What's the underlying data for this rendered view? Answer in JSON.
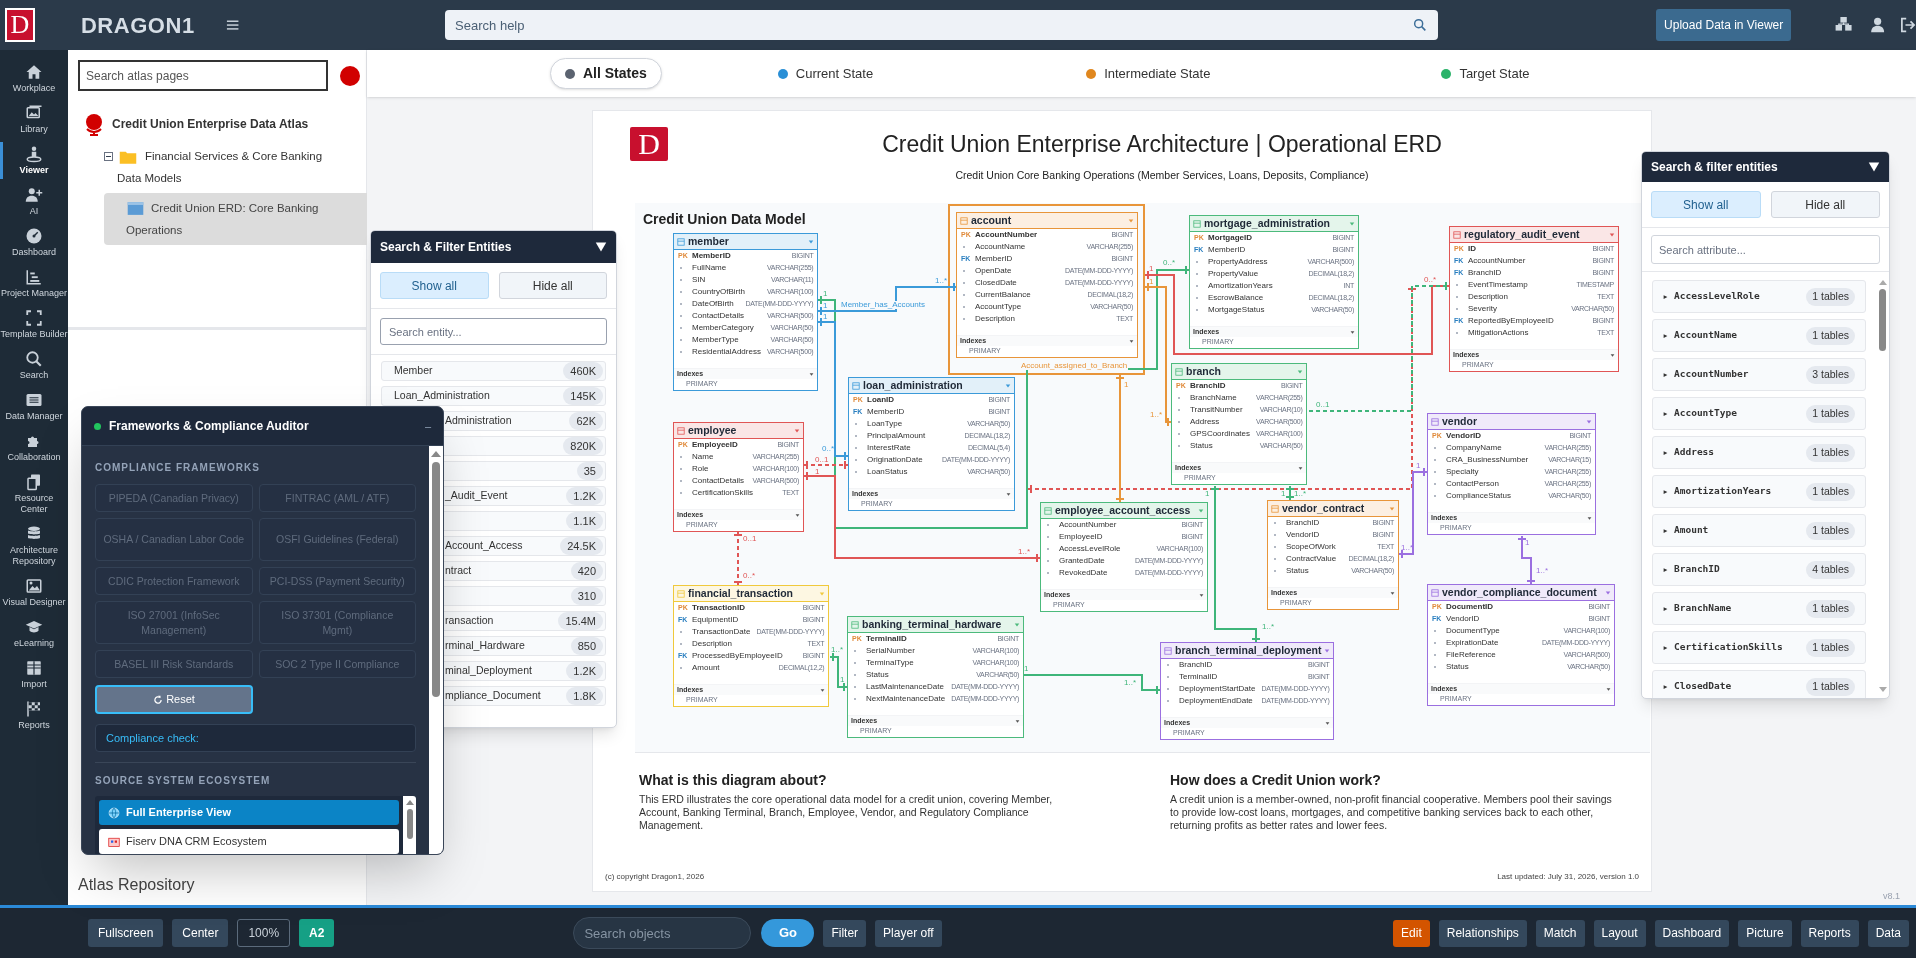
{
  "topbar": {
    "logo": "D",
    "brand": "DRAGON1",
    "search_placeholder": "Search help",
    "upload_button": "Upload Data in Viewer"
  },
  "sidebar": {
    "items": [
      {
        "label": "Workplace",
        "selected": false
      },
      {
        "label": "Library",
        "selected": false
      },
      {
        "label": "Viewer",
        "selected": true
      },
      {
        "label": "AI",
        "selected": false
      },
      {
        "label": "Dashboard",
        "selected": false
      },
      {
        "label": "Project Manager",
        "selected": false
      },
      {
        "label": "Template Builder",
        "selected": false
      },
      {
        "label": "Search",
        "selected": false
      },
      {
        "label": "Data Manager",
        "selected": false
      },
      {
        "label": "Collaboration",
        "selected": false
      },
      {
        "label": "Resource Center",
        "selected": false
      },
      {
        "label": "Architecture Repository",
        "selected": false
      },
      {
        "label": "Visual Designer",
        "selected": false
      },
      {
        "label": "eLearning",
        "selected": false
      },
      {
        "label": "Import",
        "selected": false
      },
      {
        "label": "Reports",
        "selected": false
      }
    ]
  },
  "atlas": {
    "search_placeholder": "Search atlas pages",
    "root": {
      "label": "Credit Union Enterprise Data Atlas",
      "children": [
        {
          "label": "Financial Services & Core Banking Data Models",
          "expanded": true,
          "children": [
            {
              "label": "Credit Union ERD: Core Banking Operations",
              "selected": true
            }
          ]
        }
      ]
    },
    "footer": "Atlas Repository"
  },
  "states": [
    {
      "label": "All States",
      "selected": true,
      "color": "#5b6370"
    },
    {
      "label": "Current State",
      "selected": false,
      "color": "#2a8fd6"
    },
    {
      "label": "Intermediate State",
      "selected": false,
      "color": "#e0871e"
    },
    {
      "label": "Target State",
      "selected": false,
      "color": "#2bb36a"
    }
  ],
  "diagram": {
    "logo": "D",
    "title": "Credit Union Enterprise Architecture | Operational ERD",
    "subtitle": "Credit Union Core Banking Operations (Member Services, Loans, Deposits, Compliance)",
    "model_title": "Credit Union Data Model",
    "tables": [
      {
        "name": "member",
        "color": "#3b9ad9",
        "columns": [
          {
            "key": "PK",
            "name": "MemberID",
            "type": "BIGINT"
          },
          {
            "name": "FullName",
            "type": "VARCHAR(255)"
          },
          {
            "name": "SIN",
            "type": "VARCHAR(11)"
          },
          {
            "name": "CountryOfBirth",
            "type": "VARCHAR(100)"
          },
          {
            "name": "DateOfBirth",
            "type": "DATE(MM-DDD-YYYY)"
          },
          {
            "name": "ContactDetails",
            "type": "VARCHAR(500)"
          },
          {
            "name": "MemberCategory",
            "type": "VARCHAR(50)"
          },
          {
            "name": "MemberType",
            "type": "VARCHAR(50)"
          },
          {
            "name": "ResidentialAddress",
            "type": "VARCHAR(500)"
          }
        ],
        "indexes_label": "Indexes",
        "indexes": [
          "PRIMARY"
        ]
      },
      {
        "name": "account",
        "color": "#e8953a",
        "columns": [
          {
            "key": "PK",
            "name": "AccountNumber",
            "type": "BIGINT"
          },
          {
            "name": "AccountName",
            "type": "VARCHAR(255)"
          },
          {
            "key": "FK",
            "name": "MemberID",
            "type": "BIGINT"
          },
          {
            "name": "OpenDate",
            "type": "DATE(MM-DDD-YYYY)"
          },
          {
            "name": "ClosedDate",
            "type": "DATE(MM-DDD-YYYY)"
          },
          {
            "name": "CurrentBalance",
            "type": "DECIMAL(18,2)"
          },
          {
            "name": "AccountType",
            "type": "VARCHAR(50)"
          },
          {
            "name": "Description",
            "type": "TEXT"
          }
        ],
        "indexes_label": "Indexes",
        "indexes": [
          "PRIMARY"
        ]
      },
      {
        "name": "mortgage_administration",
        "color": "#4cba7c",
        "columns": [
          {
            "key": "PK",
            "name": "MortgageID",
            "type": "BIGINT"
          },
          {
            "key": "FK",
            "name": "MemberID",
            "type": "BIGINT"
          },
          {
            "name": "PropertyAddress",
            "type": "VARCHAR(500)"
          },
          {
            "name": "PropertyValue",
            "type": "DECIMAL(18,2)"
          },
          {
            "name": "AmortizationYears",
            "type": "INT"
          },
          {
            "name": "EscrowBalance",
            "type": "DECIMAL(18,2)"
          },
          {
            "name": "MortgageStatus",
            "type": "VARCHAR(50)"
          }
        ],
        "indexes_label": "Indexes",
        "indexes": [
          "PRIMARY"
        ]
      },
      {
        "name": "regulatory_audit_event",
        "color": "#e05555",
        "columns": [
          {
            "key": "PK",
            "name": "ID",
            "type": "BIGINT"
          },
          {
            "key": "FK",
            "name": "AccountNumber",
            "type": "BIGINT"
          },
          {
            "key": "FK",
            "name": "BranchID",
            "type": "BIGINT"
          },
          {
            "name": "EventTimestamp",
            "type": "TIMESTAMP"
          },
          {
            "name": "Description",
            "type": "TEXT"
          },
          {
            "name": "Severity",
            "type": "VARCHAR(50)"
          },
          {
            "key": "FK",
            "name": "ReportedByEmployeeID",
            "type": "BIGINT"
          },
          {
            "name": "MitigationActions",
            "type": "TEXT"
          }
        ],
        "indexes_label": "Indexes",
        "indexes": [
          "PRIMARY"
        ]
      },
      {
        "name": "loan_administration",
        "color": "#3b9ad9",
        "columns": [
          {
            "key": "PK",
            "name": "LoanID",
            "type": "BIGINT"
          },
          {
            "key": "FK",
            "name": "MemberID",
            "type": "BIGINT"
          },
          {
            "name": "LoanType",
            "type": "VARCHAR(50)"
          },
          {
            "name": "PrincipalAmount",
            "type": "DECIMAL(18,2)"
          },
          {
            "name": "InterestRate",
            "type": "DECIMAL(5,4)"
          },
          {
            "name": "OriginationDate",
            "type": "DATE(MM-DDD-YYYY)"
          },
          {
            "name": "LoanStatus",
            "type": "VARCHAR(50)"
          }
        ],
        "indexes_label": "Indexes",
        "indexes": [
          "PRIMARY"
        ]
      },
      {
        "name": "branch",
        "color": "#4cba7c",
        "columns": [
          {
            "key": "PK",
            "name": "BranchID",
            "type": "BIGINT"
          },
          {
            "name": "BranchName",
            "type": "VARCHAR(255)"
          },
          {
            "name": "TransitNumber",
            "type": "VARCHAR(10)"
          },
          {
            "name": "Address",
            "type": "VARCHAR(500)"
          },
          {
            "name": "GPSCoordinates",
            "type": "VARCHAR(100)"
          },
          {
            "name": "Status",
            "type": "VARCHAR(50)"
          }
        ],
        "indexes_label": "Indexes",
        "indexes": [
          "PRIMARY"
        ]
      },
      {
        "name": "employee",
        "color": "#e05555",
        "columns": [
          {
            "key": "PK",
            "name": "EmployeeID",
            "type": "BIGINT"
          },
          {
            "name": "Name",
            "type": "VARCHAR(255)"
          },
          {
            "name": "Role",
            "type": "VARCHAR(100)"
          },
          {
            "name": "ContactDetails",
            "type": "VARCHAR(500)"
          },
          {
            "name": "CertificationSkills",
            "type": "TEXT"
          }
        ],
        "indexes_label": "Indexes",
        "indexes": [
          "PRIMARY"
        ]
      },
      {
        "name": "vendor",
        "color": "#9b6fe0",
        "columns": [
          {
            "key": "PK",
            "name": "VendorID",
            "type": "BIGINT"
          },
          {
            "name": "CompanyName",
            "type": "VARCHAR(255)"
          },
          {
            "name": "CRA_BusinessNumber",
            "type": "VARCHAR(15)"
          },
          {
            "name": "Specialty",
            "type": "VARCHAR(255)"
          },
          {
            "name": "ContactPerson",
            "type": "VARCHAR(255)"
          },
          {
            "name": "ComplianceStatus",
            "type": "VARCHAR(50)"
          }
        ],
        "indexes_label": "Indexes",
        "indexes": [
          "PRIMARY"
        ]
      },
      {
        "name": "employee_account_access",
        "color": "#4cba7c",
        "columns": [
          {
            "name": "AccountNumber",
            "type": "BIGINT"
          },
          {
            "name": "EmployeeID",
            "type": "BIGINT"
          },
          {
            "name": "AccessLevelRole",
            "type": "VARCHAR(100)"
          },
          {
            "name": "GrantedDate",
            "type": "DATE(MM-DDD-YYYY)"
          },
          {
            "name": "RevokedDate",
            "type": "DATE(MM-DDD-YYYY)"
          }
        ],
        "indexes_label": "Indexes",
        "indexes": [
          "PRIMARY"
        ]
      },
      {
        "name": "vendor_contract",
        "color": "#e8953a",
        "columns": [
          {
            "name": "BranchID",
            "type": "BIGINT"
          },
          {
            "name": "VendorID",
            "type": "BIGINT"
          },
          {
            "name": "ScopeOfWork",
            "type": "TEXT"
          },
          {
            "name": "ContractValue",
            "type": "DECIMAL(18,2)"
          },
          {
            "name": "Status",
            "type": "VARCHAR(50)"
          }
        ],
        "indexes_label": "Indexes",
        "indexes": [
          "PRIMARY"
        ]
      },
      {
        "name": "financial_transaction",
        "color": "#f0c93c",
        "columns": [
          {
            "key": "PK",
            "name": "TransactionID",
            "type": "BIGINT"
          },
          {
            "key": "FK",
            "name": "EquipmentID",
            "type": "BIGINT"
          },
          {
            "name": "TransactionDate",
            "type": "DATE(MM-DDD-YYYY)"
          },
          {
            "name": "Description",
            "type": "TEXT"
          },
          {
            "key": "FK",
            "name": "ProcessedByEmployeeID",
            "type": "BIGINT"
          },
          {
            "name": "Amount",
            "type": "DECIMAL(12,2)"
          }
        ],
        "indexes_label": "Indexes",
        "indexes": [
          "PRIMARY"
        ]
      },
      {
        "name": "banking_terminal_hardware",
        "color": "#4cba7c",
        "columns": [
          {
            "key": "PK",
            "name": "TerminalID",
            "type": "BIGINT"
          },
          {
            "name": "SerialNumber",
            "type": "VARCHAR(100)"
          },
          {
            "name": "TerminalType",
            "type": "VARCHAR(100)"
          },
          {
            "name": "Status",
            "type": "VARCHAR(50)"
          },
          {
            "name": "LastMaintenanceDate",
            "type": "DATE(MM-DDD-YYYY)"
          },
          {
            "name": "NextMaintenanceDate",
            "type": "DATE(MM-DDD-YYYY)"
          }
        ],
        "indexes_label": "Indexes",
        "indexes": [
          "PRIMARY"
        ]
      },
      {
        "name": "branch_terminal_deployment",
        "color": "#9b6fe0",
        "columns": [
          {
            "name": "BranchID",
            "type": "BIGINT"
          },
          {
            "name": "TerminalID",
            "type": "BIGINT"
          },
          {
            "name": "DeploymentStartDate",
            "type": "DATE(MM-DDD-YYYY)"
          },
          {
            "name": "DeploymentEndDate",
            "type": "DATE(MM-DDD-YYYY)"
          }
        ],
        "indexes_label": "Indexes",
        "indexes": [
          "PRIMARY"
        ]
      },
      {
        "name": "vendor_compliance_document",
        "color": "#9b6fe0",
        "columns": [
          {
            "key": "PK",
            "name": "DocumentID",
            "type": "BIGINT"
          },
          {
            "key": "FK",
            "name": "VendorID",
            "type": "BIGINT"
          },
          {
            "name": "DocumentType",
            "type": "VARCHAR(100)"
          },
          {
            "name": "ExpirationDate",
            "type": "DATE(MM-DDD-YYYY)"
          },
          {
            "name": "FileReference",
            "type": "VARCHAR(500)"
          },
          {
            "name": "Status",
            "type": "VARCHAR(50)"
          }
        ],
        "indexes_label": "Indexes",
        "indexes": [
          "PRIMARY"
        ]
      }
    ],
    "relationships": [
      {
        "color": "#3fb57a",
        "dashed": false,
        "labels": [
          "1",
          "0..*"
        ]
      },
      {
        "color": "#e05555",
        "dashed": false,
        "labels": [
          "1",
          "0..*"
        ]
      },
      {
        "name": "Member_has_Accounts",
        "color": "#3b9ad9",
        "dashed": false,
        "labels": [
          "1",
          "1..*"
        ]
      },
      {
        "name": "Account_assigned_to_Branch",
        "color": "#e8953a",
        "dashed": false,
        "labels": [
          "1",
          "1..*"
        ]
      },
      {
        "color": "#e05555",
        "dashed": true
      },
      {
        "color": "#3fb57a",
        "dashed": true,
        "labels": [
          "0..1"
        ]
      },
      {
        "color": "#3b9ad9",
        "dashed": false,
        "labels": [
          "1",
          "0..*"
        ]
      },
      {
        "color": "#e8953a",
        "dashed": false,
        "labels": [
          "1"
        ]
      },
      {
        "color": "#e05555",
        "dashed": true,
        "labels": [
          "0..1"
        ]
      },
      {
        "color": "#9b6fe0",
        "dashed": false,
        "labels": [
          "1",
          "1..*"
        ]
      },
      {
        "color": "#e05555",
        "dashed": false,
        "labels": [
          "1",
          "1..*"
        ]
      },
      {
        "color": "#3fb57a",
        "dashed": false,
        "labels": [
          "1",
          "1..*"
        ]
      },
      {
        "color": "#e05555",
        "dashed": true,
        "labels": [
          "0..1",
          "0..*"
        ]
      },
      {
        "color": "#3fb57a",
        "dashed": false,
        "labels": [
          "1",
          "1..*"
        ]
      },
      {
        "color": "#9b6fe0",
        "dashed": false,
        "labels": [
          "1",
          "1..*"
        ]
      },
      {
        "color": "#3fb57a",
        "dashed": false,
        "labels": [
          "1..*",
          "1"
        ]
      },
      {
        "color": "#3fb57a",
        "dashed": false,
        "labels": [
          "1",
          "1..*"
        ]
      }
    ],
    "notes": [
      {
        "heading": "What is this diagram about?",
        "text": "This ERD illustrates the core operational data model for a credit union, covering Member, Account, Banking Terminal, Branch, Employee, Vendor, and Regulatory Compliance Management."
      },
      {
        "heading": "How does a Credit Union work?",
        "text": "A credit union is a member-owned, non-profit financial cooperative. Members pool their savings to provide low-cost loans, mortgages, and competitive banking services back to each other, returning profits as better rates and lower fees."
      }
    ],
    "copyright": "(c) copyright Dragon1, 2026",
    "updated": "Last updated: July 31, 2026, version 1.0"
  },
  "version": "v8.1",
  "entity_panel": {
    "title": "Search & Filter Entities",
    "buttons": [
      {
        "label": "Show all",
        "selected": true
      },
      {
        "label": "Hide all",
        "selected": false
      }
    ],
    "search_placeholder": "Search entity...",
    "items": [
      {
        "label": "Member",
        "count": "460K"
      },
      {
        "label": "Loan_Administration",
        "count": "145K"
      },
      {
        "label": "Administration",
        "count": "62K"
      },
      {
        "count": "820K"
      },
      {
        "count": "35"
      },
      {
        "label": "_Audit_Event",
        "count": "1.2K"
      },
      {
        "count": "1.1K"
      },
      {
        "label": "Account_Access",
        "count": "24.5K"
      },
      {
        "label": "ntract",
        "count": "420"
      },
      {
        "count": "310"
      },
      {
        "label": "ransaction",
        "count": "15.4M"
      },
      {
        "label": "rminal_Hardware",
        "count": "850"
      },
      {
        "label": "minal_Deployment",
        "count": "1.2K"
      },
      {
        "label": "mpliance_Document",
        "count": "1.8K"
      }
    ]
  },
  "compliance_panel": {
    "title": "Frameworks & Compliance Auditor",
    "minimize": "–",
    "frameworks_heading": "COMPLIANCE FRAMEWORKS",
    "frameworks": [
      {
        "label": "PIPEDA (Canadian Privacy)",
        "selected": false
      },
      {
        "label": "FINTRAC (AML / ATF)",
        "selected": false
      },
      {
        "label": "OSHA / Canadian Labor Code",
        "selected": false
      },
      {
        "label": "OSFI Guidelines (Federal)",
        "selected": false
      },
      {
        "label": "CDIC Protection Framework",
        "selected": false
      },
      {
        "label": "PCI-DSS (Payment Security)",
        "selected": false
      },
      {
        "label": "ISO 27001 (InfoSec Management)",
        "selected": false
      },
      {
        "label": "ISO 37301 (Compliance Mgmt)",
        "selected": false
      },
      {
        "label": "BASEL III Risk Standards",
        "selected": false
      },
      {
        "label": "SOC 2 Type II Compliance",
        "selected": false
      }
    ],
    "reset": "Reset",
    "check_label": "Compliance check:",
    "ecosystem_heading": "SOURCE SYSTEM ECOSYSTEM",
    "ecosystems": [
      {
        "label": "Full Enterprise View",
        "selected": true
      },
      {
        "label": "Fiserv DNA CRM Ecosystem",
        "selected": false
      }
    ]
  },
  "attribute_panel": {
    "title": "Search & filter entities",
    "buttons": [
      {
        "label": "Show all",
        "selected": true
      },
      {
        "label": "Hide all",
        "selected": false
      }
    ],
    "search_placeholder": "Search attribute...",
    "items": [
      {
        "name": "AccessLevelRole",
        "count": "1 tables"
      },
      {
        "name": "AccountName",
        "count": "1 tables"
      },
      {
        "name": "AccountNumber",
        "count": "3 tables"
      },
      {
        "name": "AccountType",
        "count": "1 tables"
      },
      {
        "name": "Address",
        "count": "1 tables"
      },
      {
        "name": "AmortizationYears",
        "count": "1 tables"
      },
      {
        "name": "Amount",
        "count": "1 tables"
      },
      {
        "name": "BranchID",
        "count": "4 tables"
      },
      {
        "name": "BranchName",
        "count": "1 tables"
      },
      {
        "name": "CertificationSkills",
        "count": "1 tables"
      },
      {
        "name": "ClosedDate",
        "count": "1 tables"
      }
    ]
  },
  "bottom_bar": {
    "left_buttons": [
      {
        "label": "Fullscreen",
        "kind": "plain"
      },
      {
        "label": "Center",
        "kind": "plain"
      },
      {
        "label": "100%",
        "kind": "outline"
      },
      {
        "label": "A2",
        "kind": "accent"
      }
    ],
    "search_placeholder": "Search objects",
    "go": "Go",
    "mid_buttons": [
      "Filter",
      "Player off"
    ],
    "right_buttons": [
      {
        "label": "Edit",
        "selected": true
      },
      {
        "label": "Relationships",
        "selected": false
      },
      {
        "label": "Match",
        "selected": false
      },
      {
        "label": "Layout",
        "selected": false
      },
      {
        "label": "Dashboard",
        "selected": false
      },
      {
        "label": "Picture",
        "selected": false
      },
      {
        "label": "Reports",
        "selected": false
      },
      {
        "label": "Data",
        "selected": false
      }
    ]
  }
}
